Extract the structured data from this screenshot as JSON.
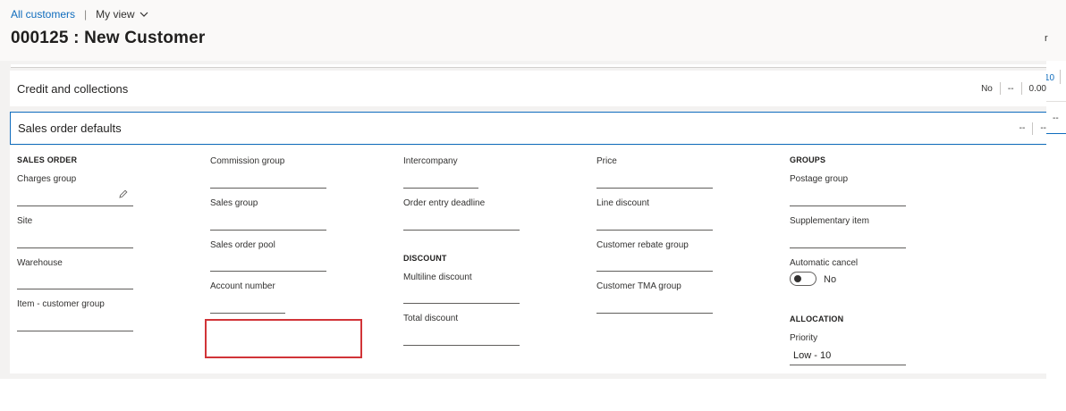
{
  "breadcrumb": {
    "parent": "All customers",
    "separator": "|",
    "view": "My view"
  },
  "page": {
    "title": "000125 : New Customer",
    "right_clip": "r"
  },
  "right_edge": {
    "number": "10",
    "dash": "--"
  },
  "credit_section": {
    "title": "Credit and collections",
    "summary": [
      "No",
      "--",
      "0.00"
    ]
  },
  "sales_section": {
    "title": "Sales order defaults",
    "summary": [
      "--",
      "--"
    ]
  },
  "col1": {
    "group_title": "SALES ORDER",
    "fields": [
      {
        "label": "Charges group",
        "value": ""
      },
      {
        "label": "Site",
        "value": ""
      },
      {
        "label": "Warehouse",
        "value": ""
      },
      {
        "label": "Item - customer group",
        "value": ""
      }
    ]
  },
  "col2": {
    "fields": [
      {
        "label": "Commission group",
        "value": ""
      },
      {
        "label": "Sales group",
        "value": ""
      },
      {
        "label": "Sales order pool",
        "value": ""
      },
      {
        "label": "Account number",
        "value": ""
      }
    ]
  },
  "col3": {
    "fields": [
      {
        "label": "Intercompany",
        "value": ""
      },
      {
        "label": "Order entry deadline",
        "value": ""
      }
    ],
    "discount_title": "DISCOUNT",
    "discount_fields": [
      {
        "label": "Multiline discount",
        "value": ""
      },
      {
        "label": "Total discount",
        "value": ""
      }
    ]
  },
  "col4": {
    "fields": [
      {
        "label": "Price",
        "value": ""
      },
      {
        "label": "Line discount",
        "value": ""
      },
      {
        "label": "Customer rebate group",
        "value": ""
      },
      {
        "label": "Customer TMA group",
        "value": ""
      }
    ]
  },
  "col5": {
    "group_title": "GROUPS",
    "fields": [
      {
        "label": "Postage group",
        "value": ""
      },
      {
        "label": "Supplementary item",
        "value": ""
      }
    ],
    "automatic_cancel": {
      "label": "Automatic cancel",
      "state": "No"
    },
    "allocation_title": "ALLOCATION",
    "priority": {
      "label": "Priority",
      "value": "Low - 10"
    }
  },
  "icons": [
    "chevron-down-icon",
    "edit-pencil-icon"
  ],
  "colors": {
    "accent": "#0f6cbd",
    "highlight": "#d13438"
  }
}
